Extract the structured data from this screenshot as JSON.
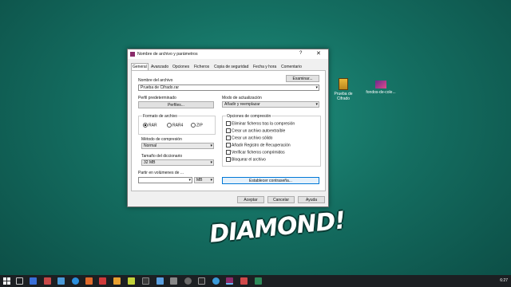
{
  "dialog": {
    "title": "Nombre de archivo y parámetros",
    "help": "?",
    "close": "✕",
    "tabs": [
      "General",
      "Avanzado",
      "Opciones",
      "Ficheros",
      "Copia de seguridad",
      "Fecha y hora",
      "Comentario"
    ],
    "archive_name_label": "Nombre del archivo",
    "archive_name_value": "Prueba de Cifrado.rar",
    "browse_button": "Examinar...",
    "profile_label": "Perfil predeterminado",
    "profiles_button": "Perfiles...",
    "update_mode_label": "Modo de actualización",
    "update_mode_value": "Añadir y reemplazar",
    "format_group": "Formato de archivo",
    "formats": [
      "RAR",
      "RAR4",
      "ZIP"
    ],
    "compression_label": "Método de compresión",
    "compression_value": "Normal",
    "dictionary_label": "Tamaño del diccionario",
    "dictionary_value": "32 MB",
    "split_label": "Partir en volúmenes de ...",
    "split_value": "",
    "split_unit": "MB",
    "options_group": "Opciones de compresión",
    "options": [
      "Eliminar ficheros tras la compresión",
      "Crear un archivo autoextraíble",
      "Crear un archivo sólido",
      "Añadir Registro de Recuperación",
      "Verificar ficheros comprimidos",
      "Bloquear el archivo"
    ],
    "password_button": "Establecer contraseña...",
    "ok_button": "Aceptar",
    "cancel_button": "Cancelar",
    "help_button": "Ayuda"
  },
  "desktop": {
    "icon1_label_line1": "Prueba de",
    "icon1_label_line2": "Cifrado",
    "icon2_label": "fondos-de-cole...",
    "logo_text": "DIAMOND!"
  },
  "taskbar": {
    "clock": "6:27"
  }
}
